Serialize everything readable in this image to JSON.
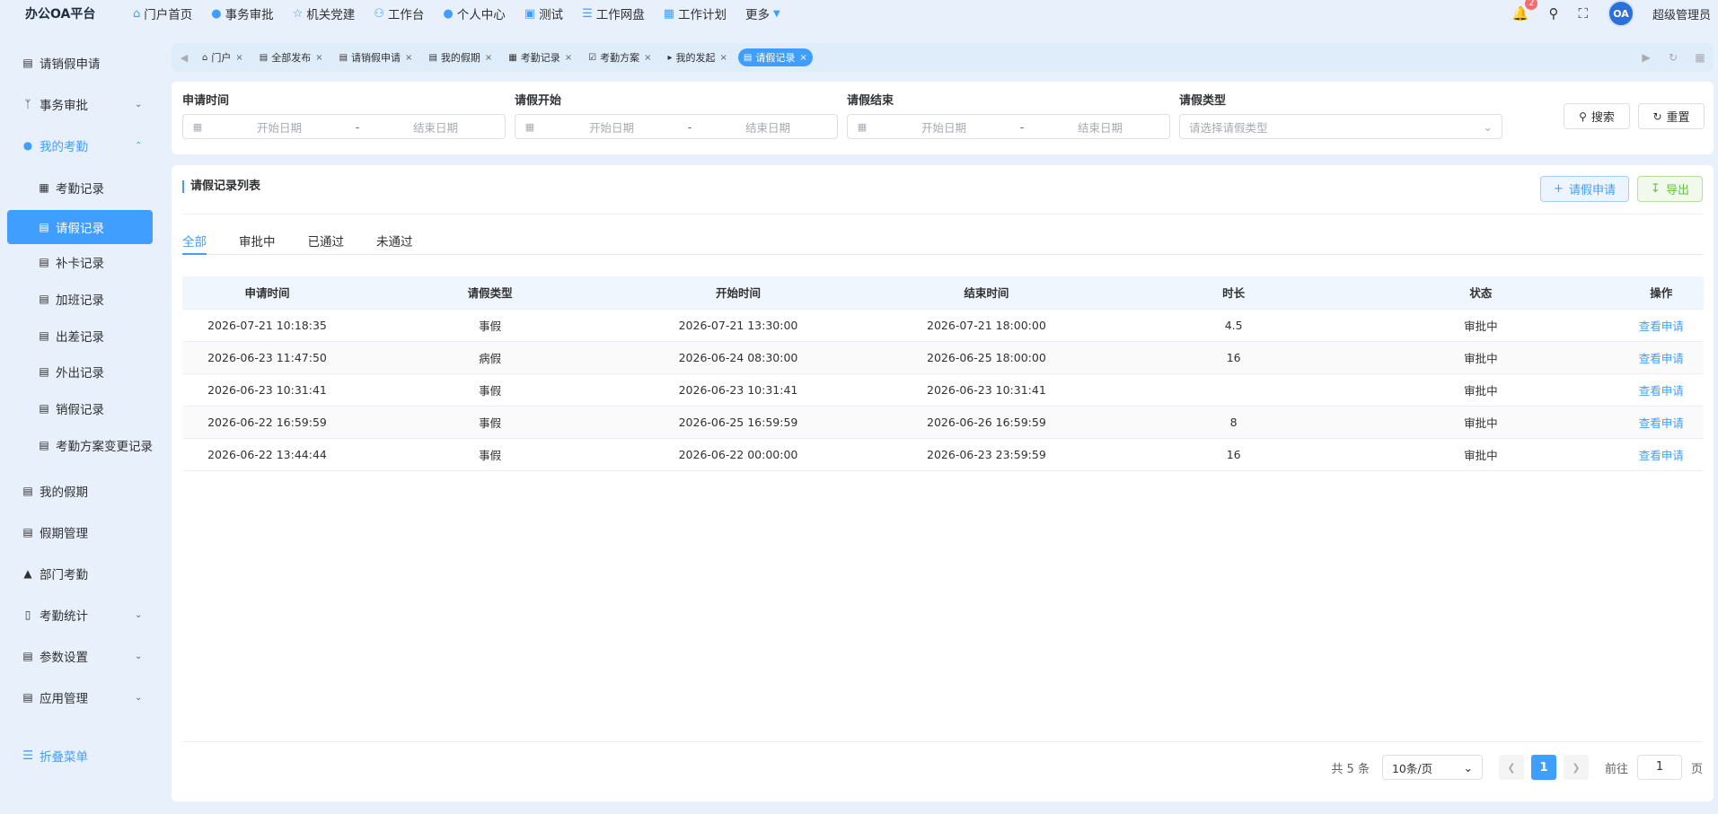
{
  "app": {
    "brand": "办公OA平台"
  },
  "topnav": [
    {
      "label": "门户首页",
      "icon": "⌂"
    },
    {
      "label": "事务审批",
      "icon": "●"
    },
    {
      "label": "机关党建",
      "icon": "☆"
    },
    {
      "label": "工作台",
      "icon": "⚇"
    },
    {
      "label": "个人中心",
      "icon": "●"
    },
    {
      "label": "测试",
      "icon": "▣"
    },
    {
      "label": "工作网盘",
      "icon": "☰"
    },
    {
      "label": "工作计划",
      "icon": "▦"
    },
    {
      "label": "更多",
      "icon": ""
    }
  ],
  "header": {
    "notification_count": "2",
    "avatar_text": "OA",
    "username": "超级管理员"
  },
  "sidebar": {
    "items": [
      {
        "label": "请销假申请"
      },
      {
        "label": "事务审批"
      },
      {
        "label": "我的考勤"
      },
      {
        "label": "考勤记录"
      },
      {
        "label": "请假记录"
      },
      {
        "label": "补卡记录"
      },
      {
        "label": "加班记录"
      },
      {
        "label": "出差记录"
      },
      {
        "label": "外出记录"
      },
      {
        "label": "销假记录"
      },
      {
        "label": "考勤方案变更记录"
      },
      {
        "label": "我的假期"
      },
      {
        "label": "假期管理"
      },
      {
        "label": "部门考勤"
      },
      {
        "label": "考勤统计"
      },
      {
        "label": "参数设置"
      },
      {
        "label": "应用管理"
      }
    ],
    "collapse_label": "折叠菜单"
  },
  "tabs": [
    {
      "label": "门户"
    },
    {
      "label": "全部发布"
    },
    {
      "label": "请销假申请"
    },
    {
      "label": "我的假期"
    },
    {
      "label": "考勤记录"
    },
    {
      "label": "考勤方案"
    },
    {
      "label": "我的发起"
    },
    {
      "label": "请假记录"
    }
  ],
  "filters": {
    "apply_time": {
      "label": "申请时间",
      "start_placeholder": "开始日期",
      "end_placeholder": "结束日期"
    },
    "leave_start": {
      "label": "请假开始",
      "start_placeholder": "开始日期",
      "end_placeholder": "结束日期"
    },
    "leave_end": {
      "label": "请假结束",
      "start_placeholder": "开始日期",
      "end_placeholder": "结束日期"
    },
    "leave_type": {
      "label": "请假类型",
      "placeholder": "请选择请假类型"
    },
    "range_separator": "-",
    "search_label": "搜索",
    "reset_label": "重置"
  },
  "list": {
    "title": "请假记录列表",
    "apply_button": "请假申请",
    "export_button": "导出",
    "status_tabs": [
      "全部",
      "审批中",
      "已通过",
      "未通过"
    ],
    "columns": [
      "申请时间",
      "请假类型",
      "开始时间",
      "结束时间",
      "时长",
      "状态",
      "操作"
    ],
    "rows": [
      {
        "apply_time": "2026-07-21 10:18:35",
        "type": "事假",
        "start": "2026-07-21 13:30:00",
        "end": "2026-07-21 18:00:00",
        "duration": "4.5",
        "status": "审批中",
        "action": "查看申请"
      },
      {
        "apply_time": "2026-06-23 11:47:50",
        "type": "病假",
        "start": "2026-06-24 08:30:00",
        "end": "2026-06-25 18:00:00",
        "duration": "16",
        "status": "审批中",
        "action": "查看申请"
      },
      {
        "apply_time": "2026-06-23 10:31:41",
        "type": "事假",
        "start": "2026-06-23 10:31:41",
        "end": "2026-06-23 10:31:41",
        "duration": "",
        "status": "审批中",
        "action": "查看申请"
      },
      {
        "apply_time": "2026-06-22 16:59:59",
        "type": "事假",
        "start": "2026-06-25 16:59:59",
        "end": "2026-06-26 16:59:59",
        "duration": "8",
        "status": "审批中",
        "action": "查看申请"
      },
      {
        "apply_time": "2026-06-22 13:44:44",
        "type": "事假",
        "start": "2026-06-22 00:00:00",
        "end": "2026-06-23 23:59:59",
        "duration": "16",
        "status": "审批中",
        "action": "查看申请"
      }
    ]
  },
  "pagination": {
    "total": "共 5 条",
    "page_size": "10条/页",
    "current_page": "1",
    "goto_label": "前往",
    "goto_value": "1",
    "page_suffix": "页"
  },
  "colors": {
    "accent": "#409eff",
    "success": "#67c23a",
    "danger": "#f56c6c",
    "background": "#e8f1fb"
  }
}
